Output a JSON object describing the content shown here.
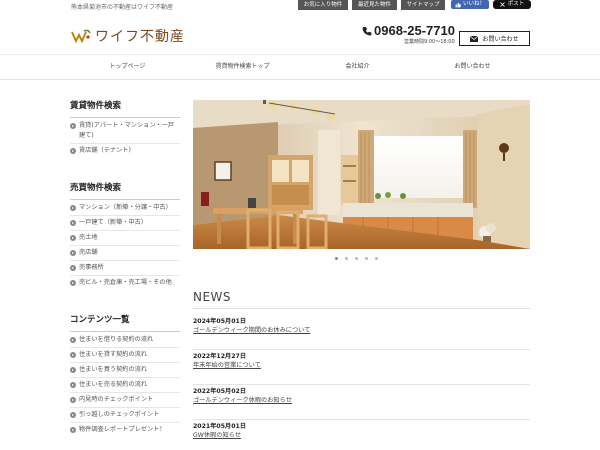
{
  "header": {
    "note": "熊本県菊池市の不動産はワイフ不動産",
    "top_buttons": [
      "お気に入り物件",
      "最近見た物件",
      "サイトマップ"
    ],
    "like_label": "いいね！",
    "post_label": "ポスト",
    "logo_text": "ワイフ不動産",
    "phone": "0968-25-7710",
    "hours": "営業時間9:00～18:00",
    "contact_label": "お問い合わせ"
  },
  "nav": {
    "items": [
      "トップページ",
      "賃貸物件検索トップ",
      "会社紹介",
      "お問い合わせ"
    ]
  },
  "sidebar": {
    "rental": {
      "title": "賃貸物件検索",
      "items": [
        "賃貸(アパート・マンション・一戸建て)",
        "賃店舗（テナント）"
      ]
    },
    "sale": {
      "title": "売買物件検索",
      "items": [
        "マンション（新築・分譲・中古）",
        "一戸建て（新築・中古）",
        "売土地",
        "売店舗",
        "売事務所",
        "売ビル・売倉庫・売工場・その他"
      ]
    },
    "contents": {
      "title": "コンテンツ一覧",
      "items": [
        "住まいを借りる契約の流れ",
        "住まいを貸す契約の流れ",
        "住まいを買う契約の流れ",
        "住まいを売る契約の流れ",
        "内見時のチェックポイント",
        "引っ越しのチェックポイント",
        "物件調査レポートプレゼント！"
      ]
    }
  },
  "slider": {
    "slide_count": 5,
    "active_index": 0
  },
  "news": {
    "title": "NEWS",
    "items": [
      {
        "date": "2024年05月01日",
        "text": "ゴールデンウィーク期間のお休みについて"
      },
      {
        "date": "2022年12月27日",
        "text": "年末年始の営業について"
      },
      {
        "date": "2022年05月02日",
        "text": "ゴールデンウィーク休暇のお知らせ"
      },
      {
        "date": "2021年05月01日",
        "text": "GW休暇の知らせ"
      }
    ]
  },
  "colors": {
    "logo": "#7a4b1e",
    "top_button_bg": "#555555",
    "like_bg": "#4267b2"
  }
}
